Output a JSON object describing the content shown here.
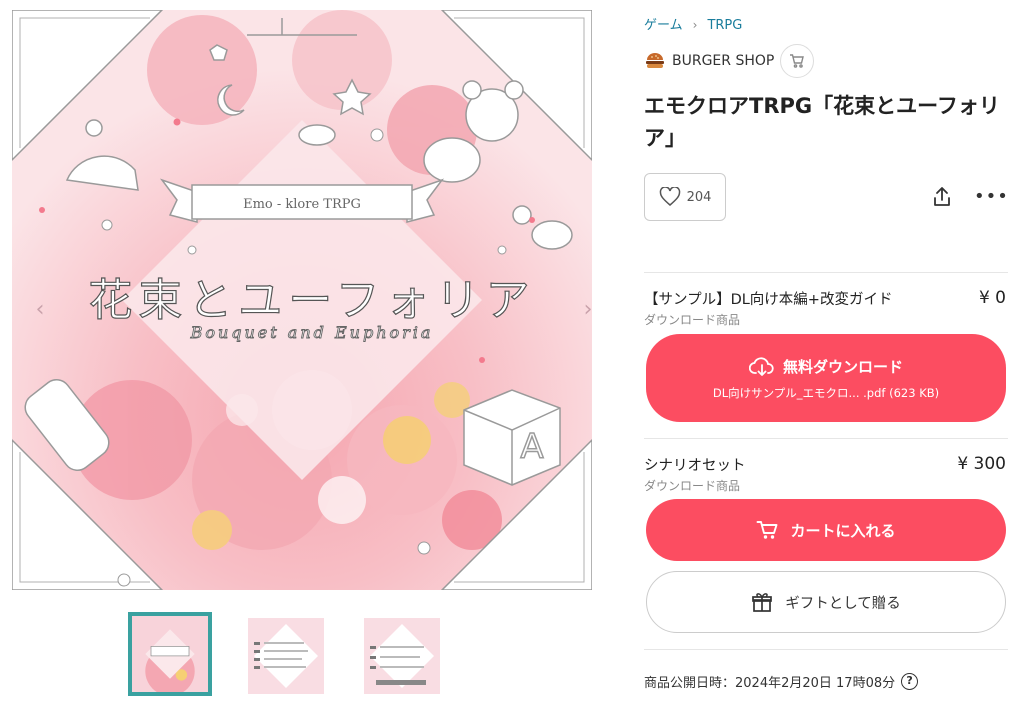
{
  "gallery": {
    "main_image": {
      "tag_text": "Emo - klore TRPG",
      "title_jp": "花束とユーフォリア",
      "title_en": "Bouquet and Euphoria",
      "block_letter": "A"
    },
    "prev_arrow": "‹",
    "next_arrow": "›",
    "thumbnails": [
      {
        "active": true
      },
      {
        "active": false
      },
      {
        "active": false
      }
    ]
  },
  "breadcrumb": {
    "items": [
      "ゲーム",
      "TRPG"
    ],
    "separator": "›"
  },
  "shop": {
    "name": "BURGER SHOP"
  },
  "product": {
    "title": "エモクロアTRPG「花束とユーフォリア」",
    "likes": "204"
  },
  "items": [
    {
      "name": "【サンプル】DL向け本編+改変ガイド",
      "type": "ダウンロード商品",
      "price": "¥ 0",
      "button_label": "無料ダウンロード",
      "file_name": "DL向けサンプル_エモクロ... .pdf (623 KB)"
    },
    {
      "name": "シナリオセット",
      "type": "ダウンロード商品",
      "price": "¥ 300",
      "button_label": "カートに入れる"
    }
  ],
  "gift_button": "ギフトとして贈る",
  "published": {
    "label": "商品公開日時：2024年2月20日 17時08分",
    "help": "?"
  },
  "colors": {
    "accent": "#fc4d61",
    "link": "#1a7d9c",
    "thumb_border": "#3aa1a0"
  },
  "icons": {
    "like": "heart-icon",
    "share": "share-icon",
    "more": "more-icon",
    "download": "cloud-download-icon",
    "cart": "cart-icon",
    "gift": "gift-icon"
  }
}
